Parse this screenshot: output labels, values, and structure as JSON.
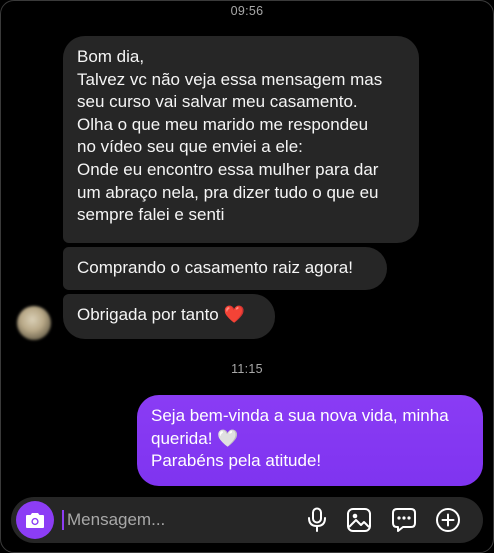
{
  "chat": {
    "time_top": "09:56",
    "time_mid": "11:15",
    "incoming": {
      "msg1": {
        "lines": [
          "Bom dia,",
          "Talvez vc não veja essa mensagem mas",
          "seu curso vai salvar meu casamento.",
          "Olha o que meu marido me respondeu",
          "no vídeo seu que enviei a ele:",
          "Onde eu encontro essa mulher para dar",
          "um abraço nela, pra dizer tudo o que eu",
          "sempre falei e senti"
        ]
      },
      "msg2": "Comprando o casamento raiz agora!",
      "msg3": "Obrigada por tanto",
      "msg3_emoji": "❤️"
    },
    "outgoing": {
      "line1": "Seja bem-vinda a sua nova vida, minha",
      "line2": "querida!",
      "line2_emoji": "🤍",
      "line3": "Parabéns pela atitude!"
    }
  },
  "composer": {
    "placeholder": "Mensagem...",
    "icons": [
      "camera-icon",
      "microphone-icon",
      "image-icon",
      "sticker-icon",
      "plus-icon"
    ],
    "accent": "#8c3df5"
  }
}
